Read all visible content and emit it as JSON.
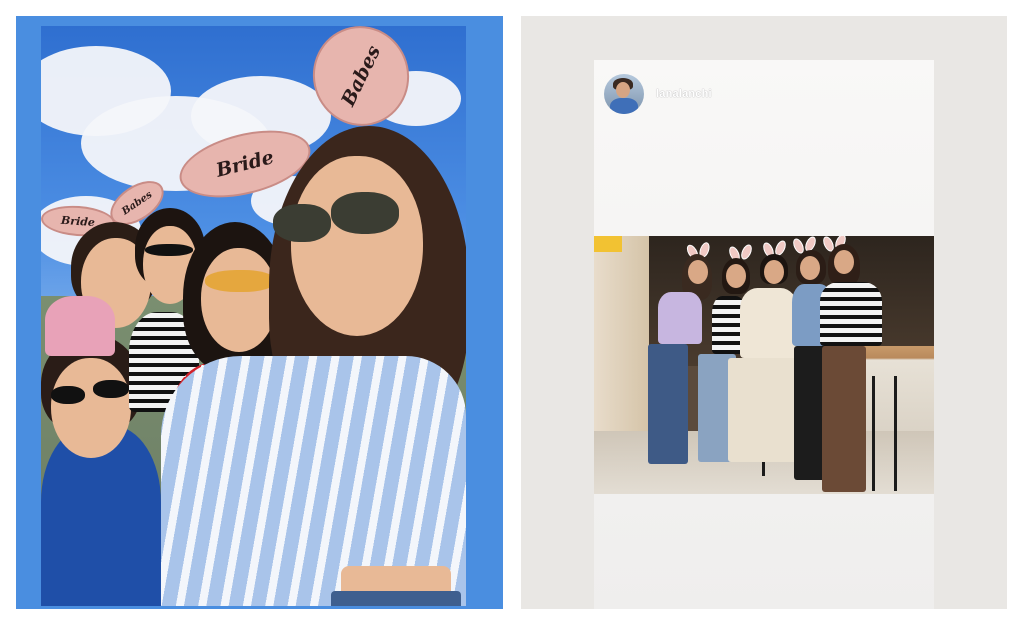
{
  "left_story": {
    "bunny_ear_labels": [
      "Babes",
      "Bride",
      "Bride",
      "Babes"
    ]
  },
  "right_story": {
    "repost_username": "lanalanchi"
  },
  "colors": {
    "left_panel_background": "#4a8ee0",
    "right_panel_background": "#e9e7e4"
  }
}
